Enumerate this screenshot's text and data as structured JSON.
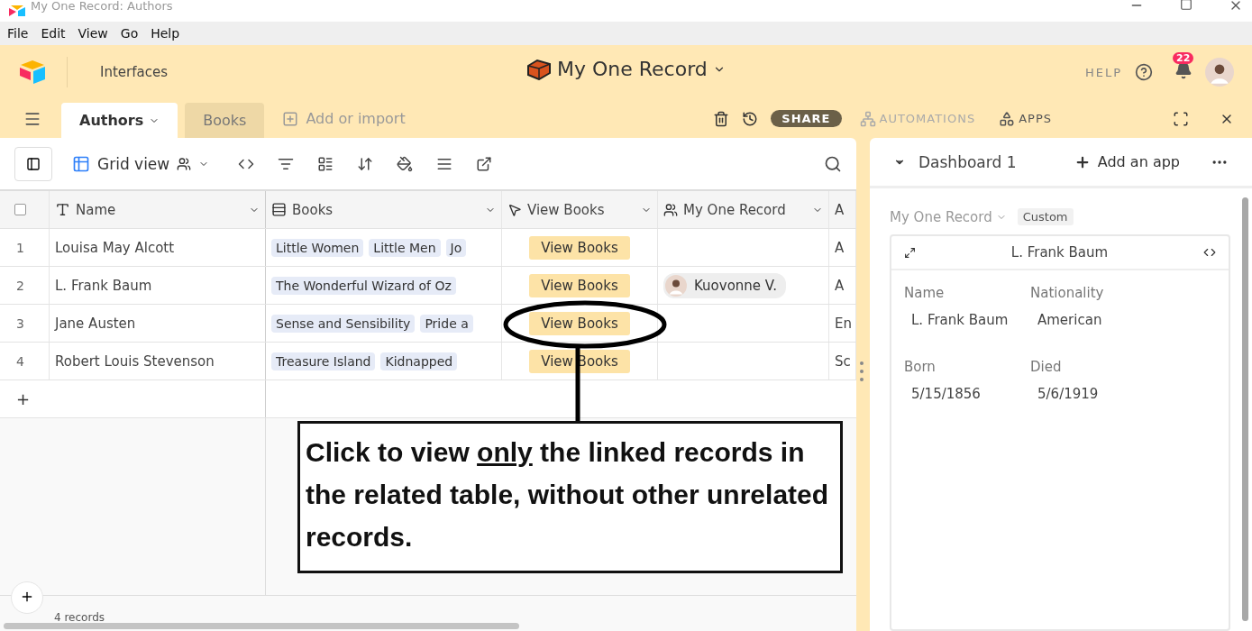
{
  "window": {
    "title": "My One Record: Authors"
  },
  "menu": [
    "File",
    "Edit",
    "View",
    "Go",
    "Help"
  ],
  "header": {
    "interfaces": "Interfaces",
    "base_name": "My One Record",
    "help": "HELP",
    "notifications": "22"
  },
  "tabs": [
    {
      "label": "Authors",
      "selected": true
    },
    {
      "label": "Books",
      "selected": false
    }
  ],
  "add_table": "Add or import",
  "actions": {
    "share": "SHARE",
    "automations": "AUTOMATIONS",
    "apps": "APPS"
  },
  "toolbar": {
    "view_name": "Grid view"
  },
  "table": {
    "select_all": {
      "checked": false
    },
    "columns": [
      {
        "label": "Name",
        "kind": "text"
      },
      {
        "label": "Books",
        "kind": "link"
      },
      {
        "label": "View Books",
        "kind": "button"
      },
      {
        "label": "My One Record",
        "kind": "user"
      },
      {
        "label": "A",
        "kind": "text"
      }
    ],
    "rows": [
      {
        "number": "1",
        "name": "Louisa May Alcott",
        "books": [
          "Little Women",
          "Little Men",
          "Jo"
        ],
        "button": "View Books",
        "user": "",
        "column_5": "A"
      },
      {
        "number": "2",
        "name": "L. Frank Baum",
        "books": [
          "The Wonderful Wizard of Oz"
        ],
        "button": "View Books",
        "user": "Kuovonne V.",
        "column_5": "A"
      },
      {
        "number": "3",
        "name": "Jane Austen",
        "books": [
          "Sense and Sensibility",
          "Pride a"
        ],
        "button": "View Books",
        "user": "",
        "column_5": "En"
      },
      {
        "number": "4",
        "name": "Robert Louis Stevenson",
        "books": [
          "Treasure Island",
          "Kidnapped"
        ],
        "button": "View Books",
        "user": "",
        "column_5": "Sc"
      }
    ],
    "add_row": "+",
    "record_count": "4 records"
  },
  "callout": {
    "before": "Click to view ",
    "underlined": "only",
    "after": " the linked records in the related table, without other unrelated records."
  },
  "dashboard": {
    "title": "Dashboard 1",
    "add_app": "Add an app",
    "table": "My One Record",
    "badge": "Custom",
    "card": {
      "title": "L. Frank Baum",
      "fields": [
        {
          "label": "Name",
          "value": "L. Frank Baum"
        },
        {
          "label": "Nationality",
          "value": "American"
        },
        {
          "label": "Born",
          "value": "5/15/1856"
        },
        {
          "label": "Died",
          "value": "5/6/1919"
        }
      ]
    }
  }
}
